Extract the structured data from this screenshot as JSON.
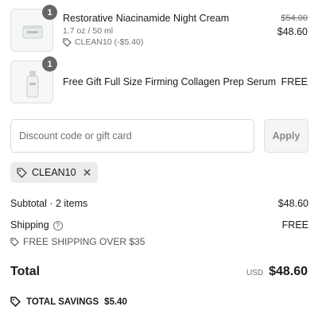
{
  "items": [
    {
      "quantity": "1",
      "title": "Restorative Niacinamide Night Cream",
      "variant": "1.7 oz / 50 ml",
      "discount": "CLEAN10 (-$5.40)",
      "original_price": "$54.00",
      "price": "$48.60",
      "image_icon": "cream-jar-icon"
    },
    {
      "quantity": "1",
      "title": "Free Gift Full Size Firming Collagen Prep Serum",
      "price": "FREE",
      "image_icon": "serum-bottle-icon"
    }
  ],
  "discount_form": {
    "placeholder": "Discount code or gift card",
    "value": "",
    "apply_label": "Apply"
  },
  "applied_code": {
    "code": "CLEAN10",
    "icon": "tag-icon",
    "remove_icon": "close-icon"
  },
  "summary": {
    "subtotal_label": "Subtotal · 2 items",
    "subtotal_value": "$48.60",
    "shipping_label": "Shipping",
    "shipping_value": "FREE",
    "shipping_note": "FREE SHIPPING OVER $35",
    "total_label": "Total",
    "currency": "USD",
    "total_value": "$48.60",
    "savings_label": "TOTAL SAVINGS",
    "savings_value": "$5.40"
  },
  "colors": {
    "text": "#1a1a1a",
    "muted": "#707070",
    "badge": "#666666",
    "chip_bg": "#ebebeb",
    "border": "#d9d9d9"
  }
}
